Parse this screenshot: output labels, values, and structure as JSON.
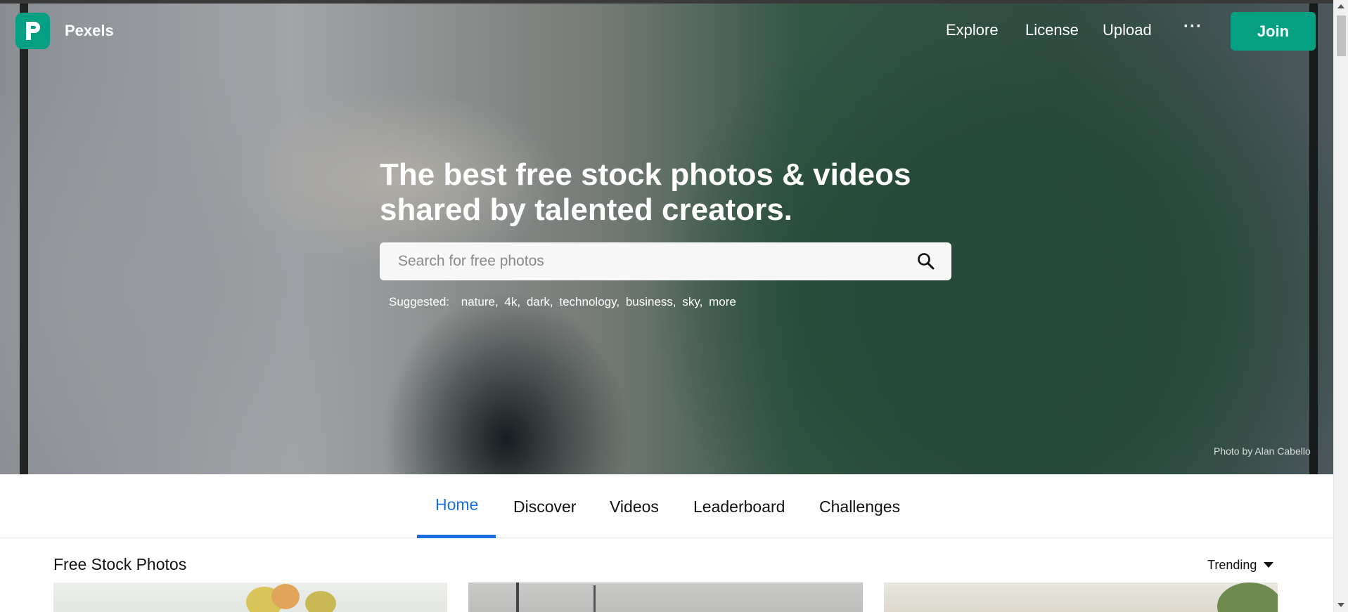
{
  "header": {
    "brand": "Pexels",
    "nav": [
      "Explore",
      "License",
      "Upload"
    ],
    "more": "···",
    "join_label": "Join"
  },
  "hero": {
    "headline_line1": "The best free stock photos & videos",
    "headline_line2": "shared by talented creators.",
    "search_placeholder": "Search for free photos",
    "suggested_label": "Suggested:",
    "suggested": [
      "nature,",
      "4k,",
      "dark,",
      "technology,",
      "business,",
      "sky,",
      "more"
    ],
    "credit": "Photo by Alan Cabello"
  },
  "tabs": [
    "Home",
    "Discover",
    "Videos",
    "Leaderboard",
    "Challenges"
  ],
  "active_tab": "Home",
  "section": {
    "title": "Free Stock Photos",
    "sort_label": "Trending"
  },
  "colors": {
    "brand": "#05a081",
    "accent": "#1a6fde"
  }
}
